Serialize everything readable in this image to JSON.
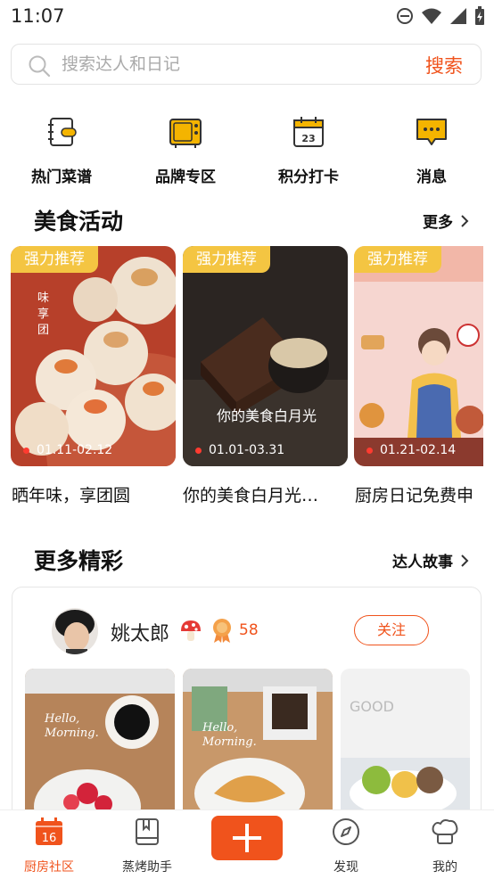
{
  "status": {
    "time": "11:07"
  },
  "search": {
    "placeholder": "搜索达人和日记",
    "button": "搜索"
  },
  "quick_nav": [
    {
      "label": "热门菜谱",
      "icon": "recipe-book-icon"
    },
    {
      "label": "品牌专区",
      "icon": "brand-oven-icon"
    },
    {
      "label": "积分打卡",
      "icon": "calendar-checkin-icon"
    },
    {
      "label": "消息",
      "icon": "message-bubble-icon"
    }
  ],
  "food_events": {
    "title": "美食活动",
    "more": "更多",
    "cards": [
      {
        "badge": "强力推荐",
        "date": "01.11-02.12",
        "title": "晒年味，享团圆"
      },
      {
        "badge": "强力推荐",
        "date": "01.01-03.31",
        "title": "你的美食白月光…"
      },
      {
        "badge": "强力推荐",
        "date": "01.21-02.14",
        "title": "厨房日记免费申"
      }
    ]
  },
  "more_section": {
    "title": "更多精彩",
    "more": "达人故事",
    "user": {
      "name": "姚太郎",
      "points": "58",
      "follow": "关注"
    }
  },
  "tabbar": [
    {
      "label": "厨房社区",
      "icon": "calendar-16-icon",
      "active": true
    },
    {
      "label": "蒸烤助手",
      "icon": "book-icon",
      "active": false
    },
    {
      "label": "",
      "icon": "add-icon",
      "active": false
    },
    {
      "label": "发现",
      "icon": "compass-icon",
      "active": false
    },
    {
      "label": "我的",
      "icon": "chef-hat-icon",
      "active": false
    }
  ],
  "colors": {
    "accent": "#f0531c",
    "badge": "#f4c542",
    "icon_yellow": "#f4b400"
  }
}
